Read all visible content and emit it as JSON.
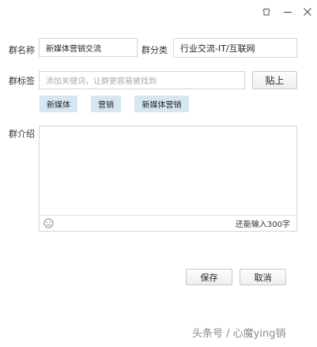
{
  "window": {
    "icons": [
      "skin-icon",
      "minimize-icon",
      "close-icon"
    ]
  },
  "form": {
    "group_name_label": "群名称",
    "group_name_value": "新媒体营销交流",
    "group_category_label": "群分类",
    "group_category_value": "行业交流-IT/互联网",
    "group_tags_label": "群标签",
    "group_tags_placeholder": "添加关键词，让群更容易被找到",
    "paste_button_label": "贴上",
    "tags": [
      {
        "label": "新媒体"
      },
      {
        "label": "营销"
      },
      {
        "label": "新媒体营销"
      }
    ],
    "group_intro_label": "群介绍",
    "group_intro_value": "",
    "remaining_chars_text": "还能输入300字"
  },
  "actions": {
    "save_label": "保存",
    "cancel_label": "取消"
  },
  "watermark": {
    "text": "头条号 / 心魔ying销"
  },
  "colors": {
    "tag_background": "#d6e6f2",
    "border": "#d4d4d4",
    "placeholder_text": "#aaaaaa"
  }
}
